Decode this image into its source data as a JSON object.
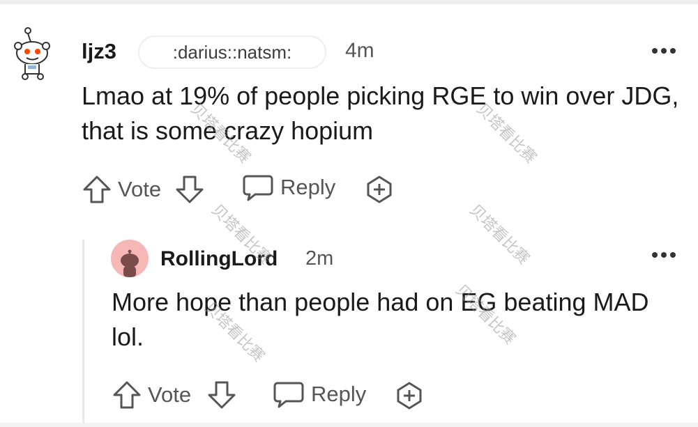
{
  "comments": [
    {
      "username": "ljz3",
      "flair": ":darius::natsm:",
      "time": "4m",
      "body": "Lmao at 19% of people picking RGE to win over JDG, that is some crazy hopium",
      "actions": {
        "vote": "Vote",
        "reply": "Reply"
      }
    },
    {
      "username": "RollingLord",
      "time": "2m",
      "body": "More hope than people had on EG beating MAD lol.",
      "actions": {
        "vote": "Vote",
        "reply": "Reply"
      }
    }
  ],
  "watermark": "贝塔看比赛",
  "icons": [
    "avatar",
    "upvote-icon",
    "downvote-icon",
    "reply-icon",
    "award-icon",
    "more-options-icon"
  ]
}
